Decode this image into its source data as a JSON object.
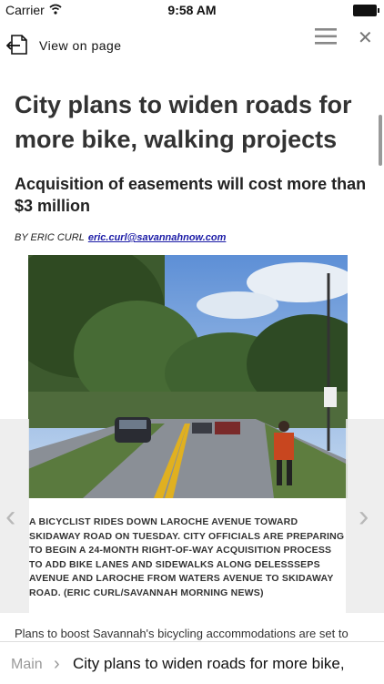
{
  "status": {
    "carrier": "Carrier",
    "time": "9:58 AM"
  },
  "toolbar": {
    "view_on_page": "View on page"
  },
  "article": {
    "headline": "City plans to widen roads for more bike, walking projects",
    "subheadline": "Acquisition of easements will cost more than $3 million",
    "byline_prefix": "BY ERIC CURL",
    "byline_email": "eric.curl@savannahnow.com",
    "caption": "A bicyclist rides down Laroche Avenue toward Skidaway Road on Tuesday. City officials are preparing to begin a 24-month right-of-way acquisition process to add bike lanes and sidewalks along Delessseps Avenue and Laroche from Waters Avenue to Skidaway Road. (Eric Curl/Savannah Morning News)",
    "body_first_line": "Plans to boost Savannah's bicycling accommodations are set to"
  },
  "nav": {
    "prev_arrow": "‹",
    "next_arrow": "›"
  },
  "breadcrumb": {
    "main": "Main",
    "separator": "›",
    "current": "City plans to widen roads for more bike,"
  },
  "icons": {
    "view": "view-on-page-icon",
    "menu": "hamburger-menu-icon",
    "close": "close-icon",
    "wifi": "wifi-icon",
    "battery": "battery-icon"
  }
}
